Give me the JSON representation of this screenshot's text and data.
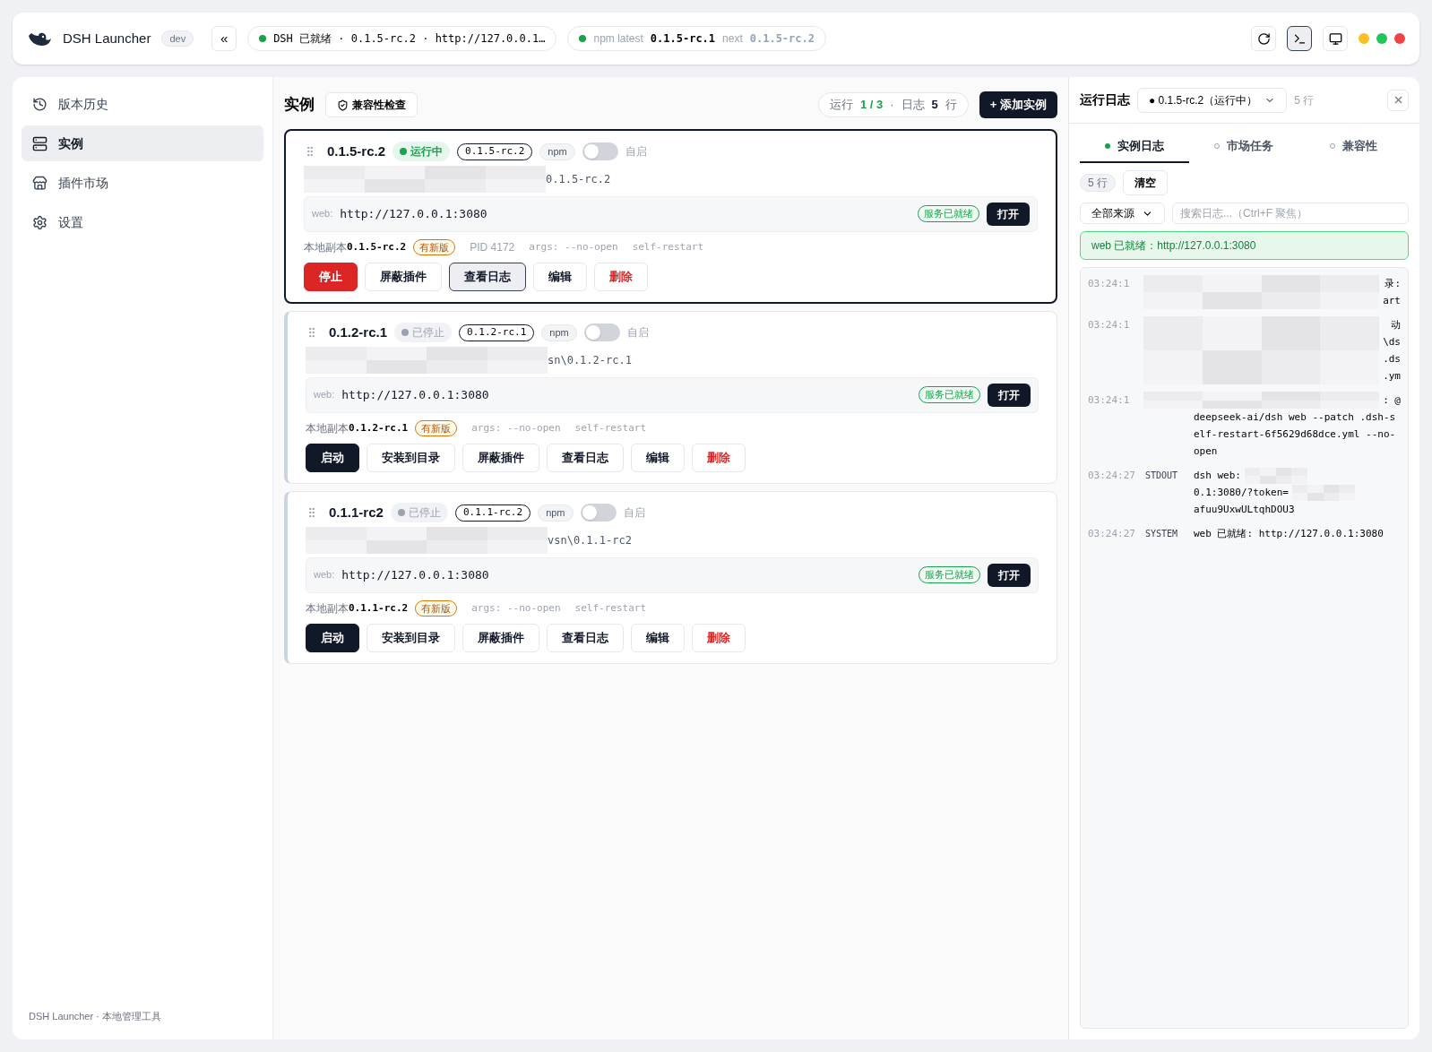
{
  "header": {
    "app_name": "DSH Launcher",
    "env_badge": "dev",
    "collapse_label": "«",
    "status_pill": {
      "online": true,
      "text": "DSH 已就绪 · 0.1.5-rc.2 · http://127.0.0.1…"
    },
    "npm_pill": {
      "online": true,
      "latest_label": "npm latest",
      "latest": "0.1.5-rc.1",
      "next_label": "next",
      "next": "0.1.5-rc.2"
    },
    "tools": [
      {
        "kind": "refresh",
        "selected": false
      },
      {
        "kind": "terminal",
        "selected": true
      },
      {
        "kind": "monitor",
        "selected": false
      }
    ],
    "window_dots": [
      {
        "color": "#fbbf24"
      },
      {
        "color": "#22c55e"
      },
      {
        "color": "#ef4444"
      }
    ]
  },
  "sidebar": {
    "items": [
      {
        "kind": "history",
        "label": "版本历史",
        "selected": false
      },
      {
        "kind": "instances",
        "label": "实例",
        "selected": true
      },
      {
        "kind": "market",
        "label": "插件市场",
        "selected": false
      },
      {
        "kind": "settings",
        "label": "设置",
        "selected": false
      }
    ],
    "footer": "DSH Launcher · 本地管理工具"
  },
  "main": {
    "title": "实例",
    "compat_button": "兼容性检查",
    "summary": {
      "running_label": "运行",
      "running": "1 / 3",
      "separator": "·",
      "log_label": "日志",
      "log_count": "5",
      "log_unit": "行"
    },
    "add_button": "+ 添加实例",
    "instances": [
      {
        "name": "0.1.5-rc.2",
        "status": "运行中",
        "running": true,
        "selected": true,
        "version_tag": "0.1.5-rc.2",
        "source_tag": "npm",
        "autostart": false,
        "autostart_label": "自启",
        "path_tail": "0.1.5-rc.2",
        "web_label": "web:",
        "url": "http://127.0.0.1:3080",
        "ready_badge": "服务已就绪",
        "open_button": "打开",
        "local_label": "本地副本",
        "local_version": "0.1.5-rc.2",
        "update_badge": "有新版",
        "pid": "PID 4172",
        "args": "args: --no-open",
        "flag": "self-restart",
        "actions": [
          {
            "kind": "danger-solid",
            "label": "停止",
            "selected": false
          },
          {
            "kind": "normal",
            "label": "屏蔽插件",
            "selected": false
          },
          {
            "kind": "normal",
            "label": "查看日志",
            "selected": true
          },
          {
            "kind": "normal",
            "label": "编辑",
            "selected": false
          },
          {
            "kind": "danger",
            "label": "删除",
            "selected": false
          }
        ]
      },
      {
        "name": "0.1.2-rc.1",
        "status": "已停止",
        "running": false,
        "selected": false,
        "version_tag": "0.1.2-rc.1",
        "source_tag": "npm",
        "autostart": false,
        "autostart_label": "自启",
        "path_tail": "sn\\0.1.2-rc.1",
        "web_label": "web:",
        "url": "http://127.0.0.1:3080",
        "ready_badge": "服务已就绪",
        "open_button": "打开",
        "local_label": "本地副本",
        "local_version": "0.1.2-rc.1",
        "update_badge": "有新版",
        "args": "args: --no-open",
        "flag": "self-restart",
        "actions": [
          {
            "kind": "primary",
            "label": "启动",
            "selected": false
          },
          {
            "kind": "normal",
            "label": "安装到目录",
            "selected": false
          },
          {
            "kind": "normal",
            "label": "屏蔽插件",
            "selected": false
          },
          {
            "kind": "normal",
            "label": "查看日志",
            "selected": false
          },
          {
            "kind": "normal",
            "label": "编辑",
            "selected": false
          },
          {
            "kind": "danger",
            "label": "删除",
            "selected": false
          }
        ]
      },
      {
        "name": "0.1.1-rc2",
        "status": "已停止",
        "running": false,
        "selected": false,
        "version_tag": "0.1.1-rc.2",
        "source_tag": "npm",
        "autostart": false,
        "autostart_label": "自启",
        "path_tail": "vsn\\0.1.1-rc2",
        "web_label": "web:",
        "url": "http://127.0.0.1:3080",
        "ready_badge": "服务已就绪",
        "open_button": "打开",
        "local_label": "本地副本",
        "local_version": "0.1.1-rc.2",
        "update_badge": "有新版",
        "args": "args: --no-open",
        "flag": "self-restart",
        "actions": [
          {
            "kind": "primary",
            "label": "启动",
            "selected": false
          },
          {
            "kind": "normal",
            "label": "安装到目录",
            "selected": false
          },
          {
            "kind": "normal",
            "label": "屏蔽插件",
            "selected": false
          },
          {
            "kind": "normal",
            "label": "查看日志",
            "selected": false
          },
          {
            "kind": "normal",
            "label": "编辑",
            "selected": false
          },
          {
            "kind": "danger",
            "label": "删除",
            "selected": false
          }
        ]
      }
    ]
  },
  "log_panel": {
    "title": "运行日志",
    "instance_select": "● 0.1.5-rc.2（运行中）",
    "line_count": "5 行",
    "tabs": [
      {
        "label": "实例日志",
        "selected": true
      },
      {
        "label": "市场任务",
        "selected": false
      },
      {
        "label": "兼容性",
        "selected": false
      }
    ],
    "count_chip": "5 行",
    "clear_button": "清空",
    "source_select": "全部来源",
    "search": {
      "placeholder": "搜索日志...（Ctrl+F 聚焦）"
    },
    "banner": "web 已就绪：http://127.0.0.1:3080",
    "entries": [
      {
        "time": "03:24:1",
        "lines": [
          "录:",
          "art"
        ]
      },
      {
        "time": "03:24:1",
        "lines": [
          "动",
          "\\ds",
          ".ds",
          ".ym"
        ]
      },
      {
        "time": "03:24:1",
        "lines": [
          ": @"
        ],
        "tail": "deepseek-ai/dsh web --patch .dsh-self-restart-6f5629d68dce.yml --no-open"
      },
      {
        "time": "03:24:27",
        "source": "STDOUT",
        "segments": [
          "dsh web:",
          "0.1:3080/?token=",
          "afuu9UxwULtqhDOU3"
        ]
      },
      {
        "time": "03:24:27",
        "source": "SYSTEM",
        "segments": [
          "web 已就绪: http://127.0.0.1:3080"
        ]
      }
    ]
  }
}
